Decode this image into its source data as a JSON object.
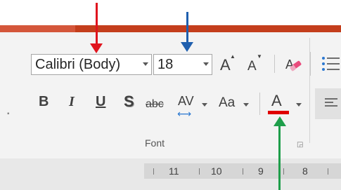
{
  "font_group": {
    "font_name": "Calibri (Body)",
    "font_size": "18",
    "grow_font_label": "A",
    "shrink_font_label": "A",
    "bold_label": "B",
    "italic_label": "I",
    "underline_label": "U",
    "shadow_label": "S",
    "strikethrough_label": "abc",
    "char_spacing_label": "AV",
    "char_spacing_arrow": "⟷",
    "change_case_label": "Aa",
    "font_color_label": "A",
    "group_label": "Font"
  },
  "ruler": {
    "numbers": [
      "11",
      "10",
      "9",
      "8"
    ]
  },
  "colors": {
    "ribbon_accent": "#c43e1c",
    "font_color_swatch": "#e00000",
    "arrow_red": "#e0141e",
    "arrow_blue": "#1f5fae",
    "arrow_green": "#1e9e4a"
  },
  "icons": {
    "grow_font": "grow-font-icon",
    "shrink_font": "shrink-font-icon",
    "clear_formatting": "eraser-icon",
    "bullets": "bulleted-list-icon",
    "align": "align-left-icon",
    "dialog_launcher": "dialog-launcher-icon"
  }
}
